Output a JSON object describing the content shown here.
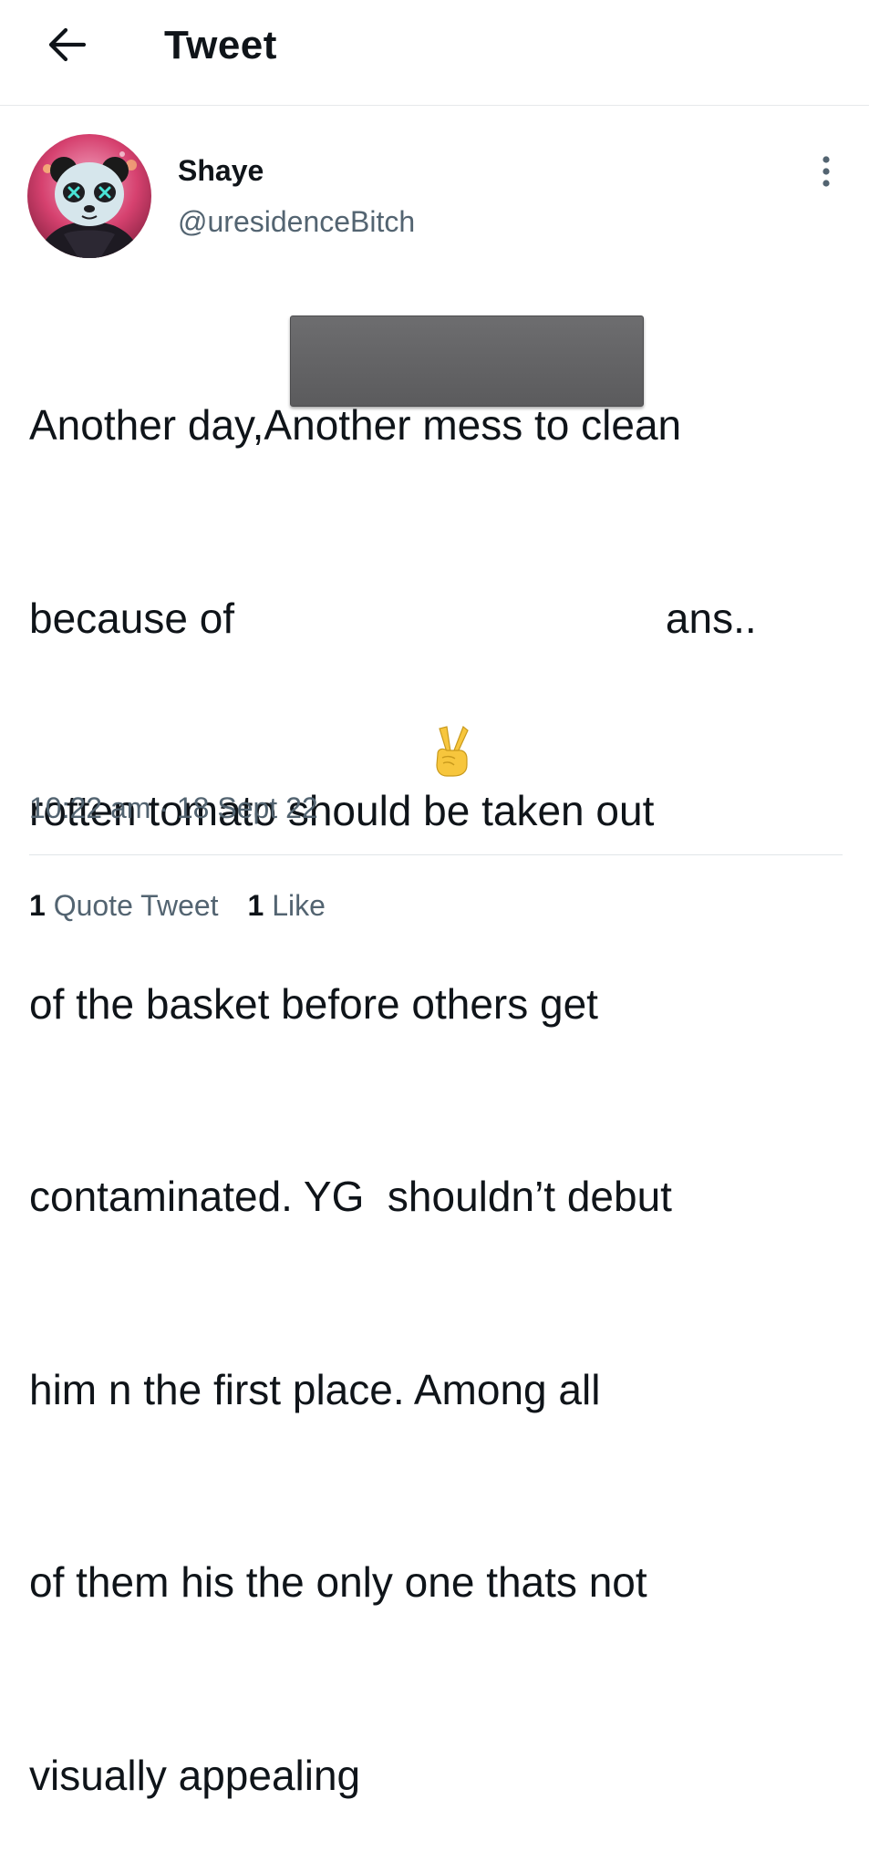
{
  "header": {
    "title": "Tweet",
    "back_icon": "arrow-left-icon"
  },
  "author": {
    "display_name": "Shaye",
    "handle": "@uresidenceBitch",
    "avatar_icon": "panda-avatar"
  },
  "tweet": {
    "lines": [
      "Another day,Another mess to clean",
      "because of                                     ans..",
      "rotten tomato should be taken out",
      "of the basket before others get",
      "contaminated. YG  shouldn’t debut",
      "him n the first place. Among all",
      "of them his the only one thats not",
      "visually appealing"
    ],
    "emoji_icon": "victory-hand-emoji",
    "time": "10:22 am",
    "separator": " · ",
    "date": "18 Sept 22"
  },
  "stats": {
    "quote_count": "1",
    "quote_label": " Quote Tweet",
    "like_count": "1",
    "like_label": " Like"
  },
  "colors": {
    "text": "#0f1419",
    "secondary": "#536471",
    "divider": "#e1e5e8",
    "redaction": "#626264"
  }
}
